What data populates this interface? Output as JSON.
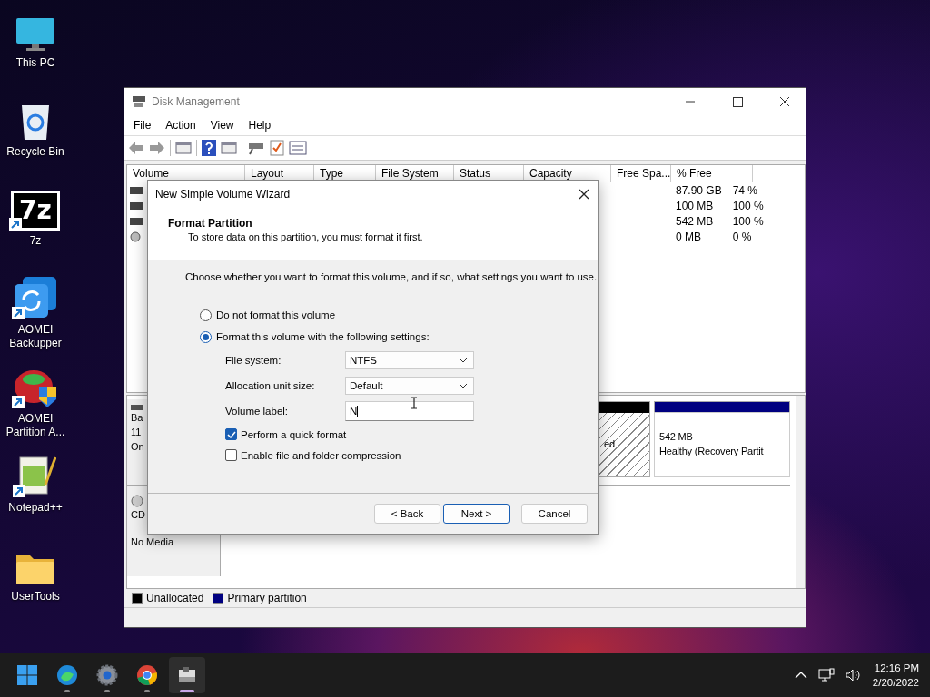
{
  "desktop_icons": [
    {
      "label": "This PC",
      "kind": "pc",
      "shortcut": false
    },
    {
      "label": "Recycle Bin",
      "kind": "bin",
      "shortcut": false
    },
    {
      "label": "7z",
      "kind": "sevenzip",
      "shortcut": true,
      "logo_text": "7z"
    },
    {
      "label": "AOMEI Backupper",
      "kind": "backup",
      "shortcut": true
    },
    {
      "label": "AOMEI Partition A...",
      "kind": "partition",
      "shortcut": true
    },
    {
      "label": "Notepad++",
      "kind": "notepad",
      "shortcut": true
    },
    {
      "label": "UserTools",
      "kind": "folder",
      "shortcut": false
    }
  ],
  "window": {
    "title": "Disk Management",
    "menu": [
      "File",
      "Action",
      "View",
      "Help"
    ],
    "table": {
      "columns": [
        "Volume",
        "Layout",
        "Type",
        "File System",
        "Status",
        "Capacity",
        "Free Spa...",
        "% Free"
      ],
      "rows": [
        {
          "kind": "disk",
          "free": "87.90 GB",
          "percent": "74 %"
        },
        {
          "kind": "disk",
          "free": "100 MB",
          "percent": "100 %"
        },
        {
          "kind": "disk",
          "free": "542 MB",
          "percent": "100 %"
        },
        {
          "kind": "cd",
          "free": "0 MB",
          "percent": "0 %"
        }
      ]
    },
    "disks": [
      {
        "kind": "hdd",
        "lines": [
          "Ba",
          "11",
          "On"
        ],
        "partitions": [
          {
            "kind": "unallocated",
            "lines": [
              "ed"
            ]
          },
          {
            "kind": "primary",
            "lines": [
              "542 MB",
              "Healthy (Recovery Partit"
            ]
          }
        ]
      },
      {
        "kind": "cd",
        "lines": [
          "CD",
          "No Media"
        ]
      }
    ],
    "legend": [
      {
        "label": "Unallocated",
        "color": "#000000"
      },
      {
        "label": "Primary partition",
        "color": "#000080"
      }
    ]
  },
  "dialog": {
    "title": "New Simple Volume Wizard",
    "heading": "Format Partition",
    "subheading": "To store data on this partition, you must format it first.",
    "instruction": "Choose whether you want to format this volume, and if so, what settings you want to use.",
    "options": [
      {
        "label": "Do not format this volume",
        "selected": false
      },
      {
        "label": "Format this volume with the following settings:",
        "selected": true
      }
    ],
    "fields": [
      {
        "kind": "select",
        "label": "File system:",
        "value": "NTFS"
      },
      {
        "kind": "select",
        "label": "Allocation unit size:",
        "value": "Default"
      },
      {
        "kind": "input",
        "label": "Volume label:",
        "value": "N"
      }
    ],
    "checkboxes": [
      {
        "label": "Perform a quick format",
        "checked": true
      },
      {
        "label": "Enable file and folder compression",
        "checked": false
      }
    ],
    "buttons": [
      {
        "label": "< Back",
        "default": false
      },
      {
        "label": "Next >",
        "default": true
      },
      {
        "label": "Cancel",
        "default": false
      }
    ]
  },
  "taskbar": {
    "apps": [
      {
        "kind": "start",
        "active": false
      },
      {
        "kind": "edge",
        "active": false
      },
      {
        "kind": "settings",
        "active": false
      },
      {
        "kind": "chrome",
        "active": false
      },
      {
        "kind": "diskmgmt",
        "active": true
      }
    ],
    "time": "12:16 PM",
    "date": "2/20/2022"
  }
}
